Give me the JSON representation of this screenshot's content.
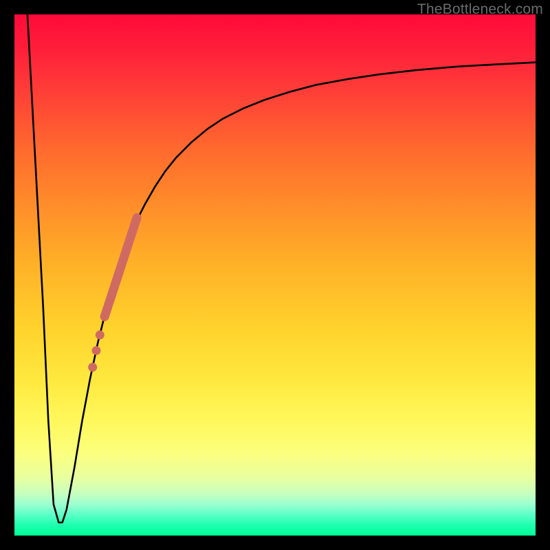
{
  "watermark": "TheBottleneck.com",
  "colors": {
    "curve": "#000000",
    "marker": "#cf6a62",
    "background_border": "#000000"
  },
  "chart_data": {
    "type": "line",
    "title": "",
    "xlabel": "",
    "ylabel": "",
    "xlim": [
      0,
      100
    ],
    "ylim": [
      0,
      100
    ],
    "grid": false,
    "legend": false,
    "series": [
      {
        "name": "curve",
        "x": [
          2.5,
          4,
          5.5,
          6.5,
          7.5,
          8.5,
          9.2,
          10.0,
          11.5,
          13,
          14.5,
          16,
          17.5,
          19,
          20.5,
          22,
          23.5,
          25,
          27,
          29,
          31,
          34,
          37,
          40,
          44,
          48,
          53,
          58,
          64,
          70,
          77,
          85,
          92,
          100
        ],
        "y": [
          100,
          72,
          44,
          22,
          6,
          2.5,
          2.5,
          5,
          13,
          22,
          30,
          37,
          43,
          48.5,
          53,
          57,
          60.5,
          63.5,
          67,
          70,
          72.5,
          75.5,
          78,
          80,
          82,
          83.6,
          85.2,
          86.5,
          87.6,
          88.5,
          89.3,
          90,
          90.4,
          90.8
        ]
      }
    ],
    "markers": {
      "name": "highlight-segment",
      "color": "#cf6a62",
      "segment": {
        "x1": 17.3,
        "y1": 42,
        "x2": 23.5,
        "y2": 61
      },
      "dots": [
        {
          "x": 16.4,
          "y": 38.5
        },
        {
          "x": 15.7,
          "y": 35.5
        },
        {
          "x": 15.0,
          "y": 32.3
        }
      ]
    }
  }
}
